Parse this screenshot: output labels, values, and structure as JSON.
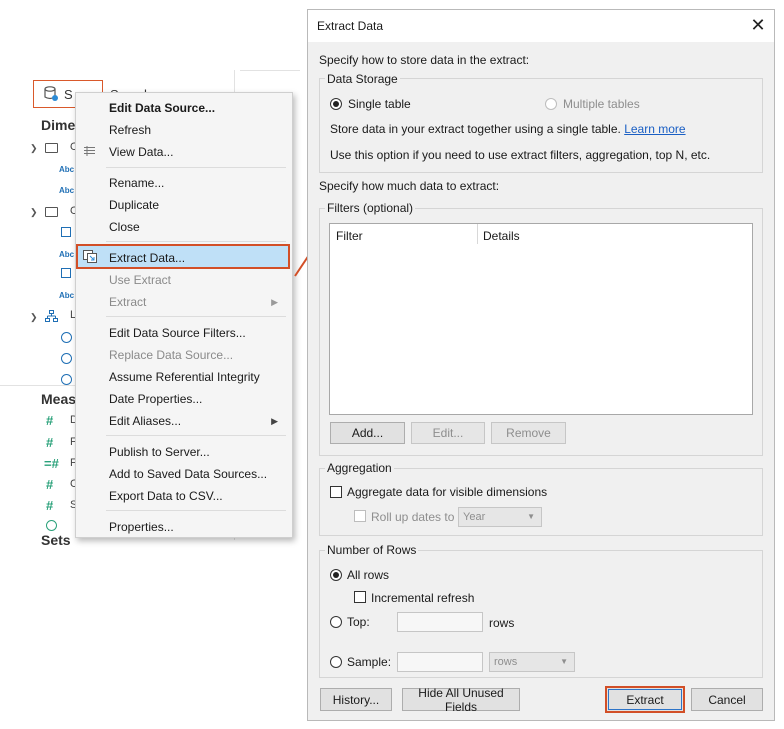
{
  "left_pane": {
    "tab_label": "S",
    "search_label": "Search",
    "dimensions_title": "Dime",
    "measures_title": "Meas",
    "sets_title": "Sets",
    "tree_letters": [
      "O",
      "O",
      "L"
    ],
    "abc": "Abc",
    "measure_letters": [
      "D",
      "F",
      "F",
      "C",
      "S"
    ]
  },
  "context_menu": {
    "items": [
      {
        "label": "Edit Data Source...",
        "bold": true,
        "disabled": false
      },
      {
        "label": "Refresh",
        "disabled": false
      },
      {
        "label": "View Data...",
        "disabled": false
      },
      {
        "label": "Rename...",
        "disabled": false
      },
      {
        "label": "Duplicate",
        "disabled": false
      },
      {
        "label": "Close",
        "disabled": false
      },
      {
        "label": "Extract Data...",
        "highlighted": true,
        "disabled": false
      },
      {
        "label": "Use Extract",
        "disabled": true
      },
      {
        "label": "Extract",
        "disabled": true,
        "submenu": true
      },
      {
        "label": "Edit Data Source Filters...",
        "disabled": false
      },
      {
        "label": "Replace Data Source...",
        "disabled": true
      },
      {
        "label": "Assume Referential Integrity",
        "disabled": false
      },
      {
        "label": "Date Properties...",
        "disabled": false
      },
      {
        "label": "Edit Aliases...",
        "disabled": false,
        "submenu": true
      },
      {
        "label": "Publish to Server...",
        "disabled": false
      },
      {
        "label": "Add to Saved Data Sources...",
        "disabled": false
      },
      {
        "label": "Export Data to CSV...",
        "disabled": false
      },
      {
        "label": "Properties...",
        "disabled": false
      }
    ]
  },
  "dialog": {
    "title": "Extract Data",
    "storage_prompt": "Specify how to store data in the extract:",
    "data_storage_legend": "Data Storage",
    "single_table_label": "Single table",
    "multiple_tables_label": "Multiple tables",
    "storage_description": "Store data in your extract together using a single table.",
    "learn_more": "Learn more",
    "storage_hint": "Use this option if you need to use extract filters, aggregation, top N, etc.",
    "amount_prompt": "Specify how much data to extract:",
    "filters_legend": "Filters (optional)",
    "filter_columns": [
      "Filter",
      "Details"
    ],
    "add_button": "Add...",
    "edit_button": "Edit...",
    "remove_button": "Remove",
    "aggregation_legend": "Aggregation",
    "aggregate_label": "Aggregate data for visible dimensions",
    "rollup_label": "Roll up dates to",
    "rollup_value": "Year",
    "rows_legend": "Number of Rows",
    "all_rows_label": "All rows",
    "incremental_label": "Incremental refresh",
    "top_label": "Top:",
    "rows_unit": "rows",
    "sample_label": "Sample:",
    "sample_unit_value": "rows",
    "history_button": "History...",
    "hide_fields_button": "Hide All Unused Fields",
    "extract_button": "Extract",
    "cancel_button": "Cancel"
  },
  "colors": {
    "highlight": "#bfe0f7",
    "callout": "#d24f27",
    "link": "#1a5fc4"
  }
}
